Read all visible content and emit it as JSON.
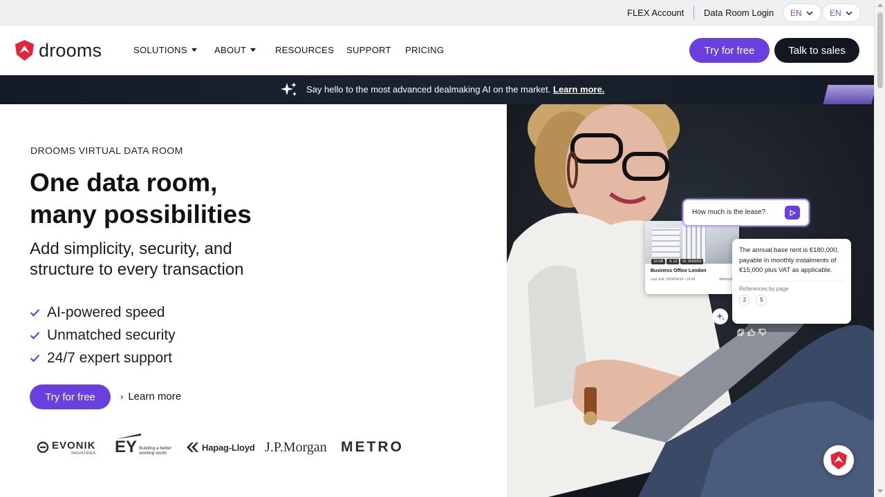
{
  "utility_bar": {
    "flex_account": "FLEX Account",
    "data_room_login": "Data Room Login",
    "lang1": "EN",
    "lang2": "EN"
  },
  "header": {
    "logo_text": "drooms",
    "nav": [
      "SOLUTIONS",
      "ABOUT",
      "RESOURCES",
      "SUPPORT",
      "PRICING"
    ],
    "try_free": "Try for free",
    "talk_sales": "Talk to sales"
  },
  "banner": {
    "text": "Say hello to the most advanced dealmaking AI on the market.",
    "link": "Learn more."
  },
  "hero": {
    "eyebrow": "DROOMS VIRTUAL DATA ROOM",
    "title_line1": "One data room,",
    "title_line2": "many possibilities",
    "sub_line1": "Add simplicity, security, and",
    "sub_line2": "structure to every transaction",
    "checks": [
      "AI-powered speed",
      "Unmatched security",
      "24/7 expert support"
    ],
    "cta": "Try for free",
    "learn_more": "Learn more"
  },
  "client_logos": {
    "evonik": "EVONIK",
    "evonik_sub": "INDUSTRIES",
    "ey": "EY",
    "ey_tag1": "Building a better",
    "ey_tag2": "working world",
    "hapag": "Hapag-Lloyd",
    "jpm": "J.P.Morgan",
    "metro": "METRO"
  },
  "ai_demo": {
    "question": "How much is the lease?",
    "doc_title": "Business Office London",
    "doc_tag1": "10 GB",
    "doc_tag2": "JL 13",
    "doc_tag3": "ID: 9209302",
    "doc_meta": "Last visit: 2024/04/18 • 14:30",
    "doc_meta2": "Administr",
    "answer": "The annual base rent is €180,000, payable in monthly instalments of €15,000 plus VAT as applicable.",
    "refs_label": "References by page",
    "refs": [
      "2",
      "5"
    ]
  },
  "colors": {
    "brand_purple": "#6a3fe0",
    "brand_red": "#e3243b",
    "dark": "#131820"
  }
}
